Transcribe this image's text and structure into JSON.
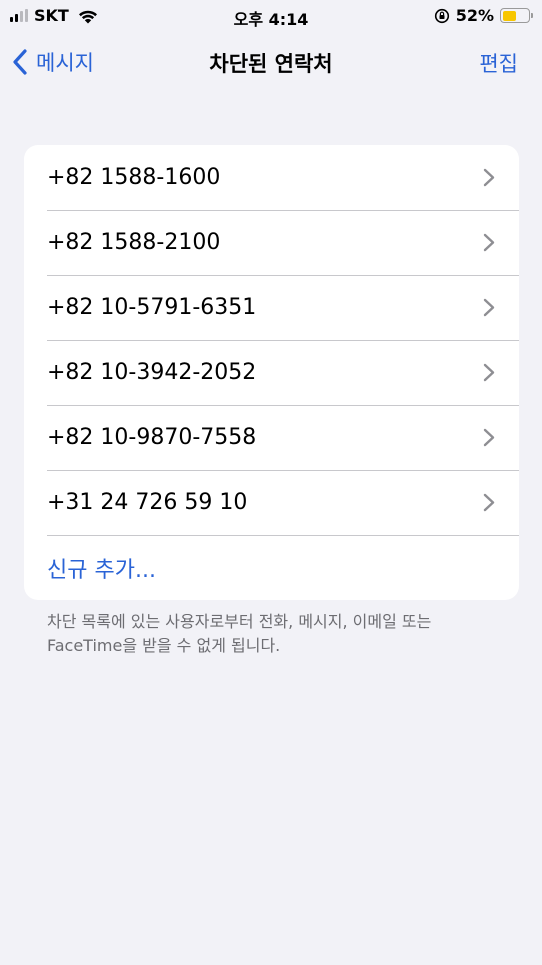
{
  "status_bar": {
    "carrier": "SKT",
    "time": "오후 4:14",
    "battery_percent": "52%",
    "battery_level": 0.52,
    "battery_color": "#f7c600"
  },
  "nav": {
    "back_label": "메시지",
    "title": "차단된 연락처",
    "edit_label": "편집"
  },
  "blocked_contacts": [
    "+82 1588-1600",
    "+82 1588-2100",
    "+82 10-5791-6351",
    "+82 10-3942-2052",
    "+82 10-9870-7558",
    "+31 24 726 59 10"
  ],
  "add_new_label": "신규 추가...",
  "footnote": "차단 목록에 있는 사용자로부터 전화, 메시지, 이메일 또는 FaceTime을 받을 수 없게 됩니다.",
  "icons": {
    "signal": "signal-icon",
    "wifi": "wifi-icon",
    "orientation_lock": "orientation-lock-icon",
    "battery": "battery-icon",
    "back": "chevron-left-icon",
    "disclosure": "chevron-right-icon"
  },
  "colors": {
    "accent": "#2a63d6",
    "background": "#f2f2f7",
    "card": "#ffffff",
    "secondary_text": "#6d6d72"
  }
}
